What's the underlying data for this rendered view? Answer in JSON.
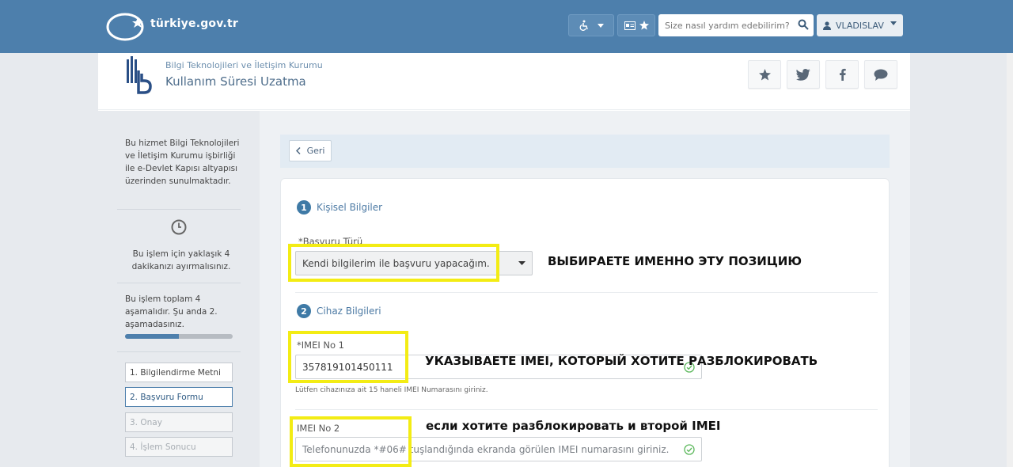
{
  "header": {
    "logo_text": "türkiye.gov.tr",
    "search_placeholder": "Size nasıl yardım edebilirim?",
    "user_name": "VLADISLAV",
    "icons": [
      "wheelchair-icon",
      "id-card-icon",
      "star-icon",
      "search-icon",
      "user-icon",
      "caret-down-icon"
    ]
  },
  "institution": {
    "name": "Bilgi Teknolojileri ve İletişim Kurumu",
    "service_title": "Kullanım Süresi Uzatma",
    "share_icons": [
      "star-icon",
      "twitter-icon",
      "facebook-icon",
      "comment-icon"
    ]
  },
  "sidebar": {
    "description": "Bu hizmet Bilgi Teknolojileri ve İletişim Kurumu işbirliği ile e-Devlet Kapısı altyapısı üzerinden sunulmaktadır.",
    "time_text": "Bu işlem için yaklaşık 4 dakikanızı ayırmalısınız.",
    "steps_text": "Bu işlem toplam 4 aşamalıdır. Şu anda 2. aşamadasınız.",
    "progress_fraction": 0.5,
    "steps": [
      {
        "label": "1. Bilgilendirme Metni",
        "state": "done"
      },
      {
        "label": "2. Başvuru Formu",
        "state": "active"
      },
      {
        "label": "3. Onay",
        "state": "disabled"
      },
      {
        "label": "4. İşlem Sonucu",
        "state": "disabled"
      }
    ]
  },
  "content": {
    "back_label": "Geri",
    "section1": {
      "number": "1",
      "title": "Kişisel Bilgiler"
    },
    "basvuru_label": "*Başvuru Türü",
    "basvuru_value": "Kendi bilgilerim ile başvuru yapacağım.",
    "section2": {
      "number": "2",
      "title": "Cihaz Bilgileri"
    },
    "imei1_label": "*IMEI No 1",
    "imei1_value": "357819101450111",
    "imei1_hint": "Lütfen cihazınıza ait 15 haneli IMEI Numarasını giriniz.",
    "imei2_label": "IMEI No 2",
    "imei2_placeholder": "Telefonunuzda *#06# tuşlandığında ekranda görülen IMEI numarasını giriniz."
  },
  "annotations": {
    "note1": "ВЫБИРАЕТЕ ИМЕННО ЭТУ ПОЗИЦИЮ",
    "note2": "УКАЗЫВАЕТЕ IMEI, КОТОРЫЙ ХОТИТЕ РАЗБЛОКИРОВАТЬ",
    "note3": "если хотите разблокировать и второй IMEI",
    "highlight_color": "#f3ec14"
  },
  "colors": {
    "header_bg": "#4d7fac",
    "accent": "#3f7aa6",
    "valid_check": "#5cb85c"
  }
}
